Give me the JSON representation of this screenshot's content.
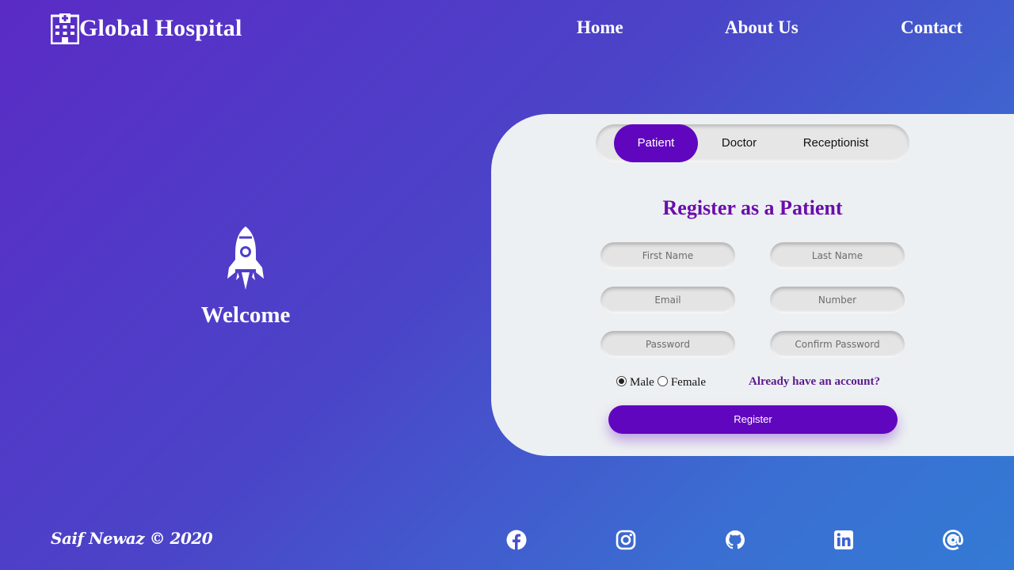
{
  "header": {
    "brand_title": "Global Hospital",
    "brand_icon": "hospital-building-icon",
    "nav": {
      "home": "Home",
      "about": "About Us",
      "contact": "Contact"
    }
  },
  "welcome": {
    "icon": "rocket-icon",
    "title": "Welcome"
  },
  "register_card": {
    "tabs": {
      "patient": "Patient",
      "doctor": "Doctor",
      "receptionist": "Receptionist",
      "active": "Patient"
    },
    "title": "Register as a Patient",
    "fields": {
      "first_name": {
        "placeholder": "First Name",
        "value": ""
      },
      "last_name": {
        "placeholder": "Last Name",
        "value": ""
      },
      "email": {
        "placeholder": "Email",
        "value": ""
      },
      "number": {
        "placeholder": "Number",
        "value": ""
      },
      "password": {
        "placeholder": "Password",
        "value": ""
      },
      "confirm_password": {
        "placeholder": "Confirm Password",
        "value": ""
      }
    },
    "gender": {
      "male": "Male",
      "female": "Female",
      "selected": "Male"
    },
    "login_link": "Already have an account?",
    "register_button": "Register"
  },
  "footer": {
    "copyright": "Saif Newaz © 2020",
    "social_icons": [
      "facebook-icon",
      "instagram-icon",
      "github-icon",
      "linkedin-icon",
      "at-icon"
    ]
  },
  "colors": {
    "accent": "#6106bf",
    "title": "#6a0dad",
    "card_bg": "#edf0f2",
    "gradient_start": "#5a2bc6",
    "gradient_end": "#337ad4"
  }
}
